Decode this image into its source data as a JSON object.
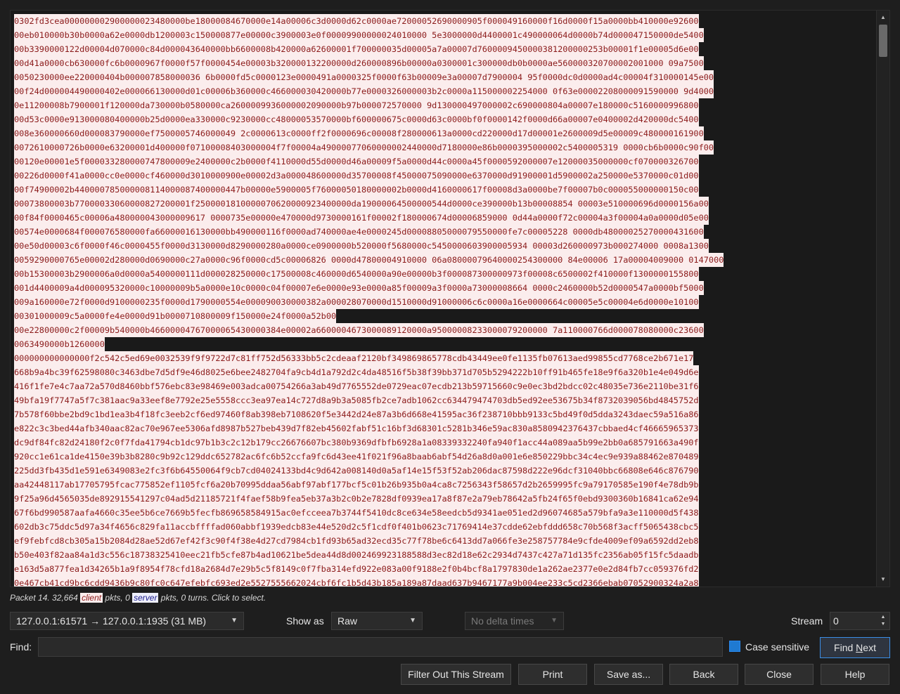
{
  "stream": {
    "segments": [
      {
        "direction": "client",
        "lines": [
          "0302fd3cea000000002900000023480000be18000084670000e14a00006c3d0000d62c0000ae72000052690000905f000049160000f16d0000f15a0000bb410000e92600",
          "00eb010000b30b0000a62e0000db1200003c150000877e00000c3900003e0f00009900000024010000 5e3000000d4400001c490000064d0000b74d000047150000de5400",
          "00b3390000122d00004d070000c84d000043640000bb6600008b420000a62600001f700000035d00005a7a00007d7600009450000381200000253b00001f1e00005d6e00",
          "00d41a0000cb630000fc6b0000967f0000f57f0000454e00003b320000132200000d260000896b00000a0300001c300000db0b0000ae560000320700002001000 09a7500",
          "0050230000ee220000404b000007858000036 6b0000fd5c0000123e0000491a0000325f0000f63b00009e3a00007d7900004 95f0000dc0d0000ad4c00004f310000145e00",
          "00f24d000004490000402e000066130000d01c00006b360000c466000030420000b77e0000326000003b2c0000a115000002254000 0f63e00002208000091590000 9d4000",
          "0e11200008b7900001f120000da730000b0580000ca2600009936000002090000b97b000072570000 9d130000497000002c690000804a00007e180000c5160000996800",
          "00d53c0000e913000080400000b25d0000ea330000c9230000cc48000053570000bf600000675c0000d63c0000bf0f0000142f0000d66a00007e0400002d420000dc5400",
          "008e360000660d000083790000ef7500005746000049 2c0000613c0000ff2f0000696c00008f280000613a0000cd220000d17d00001e2600009d5e00009c480000161900",
          "0072610000726b0000e63200001d400000f07100008403000004f7f00004a49000077060000002440000d7180000e86b0000395000002c5400005319 0000cb6b0000c90f00",
          "00120e00001e5f000033280000747800009e2400000c2b0000f4110000d55d0000d46a00009f5a0000d44c0000a45f0000592000007e12000035000000cf070000326700",
          "00226d0000f41a0000cc0e0000cf460000d3010000900e00002d3a000048600000d35700008f45000075090000e6370000d91900001d5900002a250000e5370000c01d00",
          "00f74900002b440000785000008114000087400000447b00000e5900005f76000050180000002b0000d4160000617f00008d3a0000be7f00007b0c000055000000150c00",
          "00073800003b77000033060000827200001f2500001810000070620000923400000da19000064500000544d0000ce390000b13b00008854 00003e510000696d0000156a00",
          "00f84f0000465c00006a480000043000009617 0000735e00000e470000d9730000161f00002f180000674d00006859000 0d44a0000f72c00004a3f00004a0a0000d05e00",
          "00574e0000684f000076580000fa66000016130000bb490000116f0000ad740000ae4e0000245d00008805000079550000fe7c00005228 0000db48000025270000431600",
          "00e50d00003c6f0000f46c0000455f0000d3130000d8290000280a0000ce0900000b520000f5680000c5450000603900005934 00003d260000973b000274000 0008a1300",
          "0059290000765e00002d280000d0690000c27a0000c96f0000cd5c00006826 0000d47800004910000 06a08000079640000254300000 84e00006 17a00004009000 0147000",
          "00b15300003b2900006a0d0000a5400000111d000028250000c17500008c460000d6540000a90e00000b3f000087300000973f00008c6500002f410000f1300000155800",
          "001d4400009a4d000095320000c10000009b5a0000e10c0000c04f00007e6e0000e93e0000a85f00009a3f0000a73000008664 0000c2460000b52d0000547a0000bf5000",
          "009a160000e72f0000d9100000235f0000d1790000554e000090030000382a000028070000d1510000d91000006c6c0000a16e0000664c00005e5c00004e6d0000e10100",
          "00301000009c5a0000fe4e0000d91b0000710800009f150000e24f0000a52b00"
        ]
      },
      {
        "direction": "client",
        "lines": [
          "00e22800000c2f00009b540000b46600004767000065430000384e00002a6600004673000089120000a95000008233000079200000 7a110000766d000078080000c23600",
          "0063490000b1260000"
        ]
      },
      {
        "direction": "client",
        "lines": [
          "000000000000000f2c542c5ed69e0032539f9f9722d7c81ff752d56333bb5c2cdeaaf2120bf349869865778cdb43449ee0fe1135fb07613aed99855cd7768ce2b671e17",
          "668b9a4bc39f62598080c3463dbe7d5df9e46d8025e6bee2482704fa9cb4d1a792d2c4da48516f5b38f39bb371d705b5294222b10ff91b465fe18e9f6a320b1e4e049d6e",
          "416f1fe7e4c7aa72a570d8460bbf576ebc83e98469e003adca00754266a3ab49d7765552de0729eac07ecdb213b59715660c9e0ec3bd2bdcc02c48035e736e2110be31f6",
          "49bfa19f7747a5f7c381aac9a33eef8e7792e25e5558ccc3ea97ea14c727d8a9b3a5085fb2ce7adb1062cc634479474703db5ed92ee53675b34f8732039056bd4845752d",
          "7b578f60bbe2bd9c1bd1ea3b4f18fc3eeb2cf6ed97460f8ab398eb7108620f5e3442d24e87a3b6d668e41595ac36f238710bbb9133c5bd49f0d5dda3243daec59a516a86",
          "e822c3c3bed44afb340aac82ac70e967ee5306afd8987b527beb439d7f82eb45602fabf51c16bf3d68301c5281b346e59ac830a8580942376437cbbaed4cf46665965373",
          "dc9df84fc82d24180f2c0f7fda41794cb1dc97b1b3c2c12b179cc26676607bc380b9369dfbfb6928a1a08339332240fa940f1acc44a089aa5b99e2bb0a685791663a490f",
          "920cc1e61ca1de4150e39b3b8280c9b92c129ddc652782ac6fc6b52ccfa9fc6d43ee41f021f96a8baab6abf54d26a8d0a001e6e850229bbc34c4ec9e939a88462e870489",
          "225dd3fb435d1e591e6349083e2fc3f6b64550064f9cb7cd04024133bd4c9d642a008140d0a5af14e15f53f52ab206dac87598d222e96dcf31040bbc66808e646c876790",
          "aa42448117ab17705795fcac775852ef1105fcf6a20b70995ddaa56abf97abf177bcf5c01b26b935b0a4ca8c7256343f58657d2b2659995fc9a79170585e190f4e78db9b",
          "9f25a96d4565035de892915541297c04ad5d21185721f4faef58b9fea5eb37a3b2c0b2e7828df0939ea17a8f87e2a79eb78642a5fb24f65f0ebd9300360b16841ca62e94",
          "67f6bd990587aafa4660c35ee5b6ce7669b5fecfb869658584915ac0efcceea7b3744f5410dc8ce634e58eedcb5d9341ae051ed2d96074685a579bfa9a3e110000d5f438",
          "602db3c75ddc5d97a34f4656c829fa11accbffffad060abbf1939edcb83e44e520d2c5f1cdf0f401b0623c71769414e37cdde62ebfddd658c70b568f3acff5065438cbc5",
          "ef9febfcd8cb305a15b2084d28ae52d67ef42f3c90f4f38e4d27cd7984cb1fd93b65ad32ecd35c77f78be6c6413dd7a066fe3e258757784e9cfde4009ef09a6592dd2eb8",
          "b50e403f82aa84a1d3c556c18738325410eec21fb5cfe87b4ad10621be5dea44d8d002469923188588d3ec82d18e62c2934d7437c427a71d135fc2356ab05f15fc5daadb",
          "e163d5a877fea1d34265b1a9f8954f78cfd18a2684d7e29b5c5f8149c0f7fba314efd922e083a00f9188e2f0b4bcf8a1797830de1a262ae2377e0e2d84fb7cc059376fd2",
          "0e467cb41cd9bc6cdd9436b9c80fc0c647efebfc693ed2e5527555662024cbf6fc1b5d43b185a189a87daad637b9467177a9b004ee233c5cd2366ebab07052900324a2a8"
        ]
      }
    ]
  },
  "status": {
    "prefix": "Packet 14. 32,664 ",
    "client_tag": "client",
    "middle": " pkts, 0 ",
    "server_tag": "server",
    "suffix": " pkts, 0 turns. Click to select."
  },
  "controls": {
    "conversation": "127.0.0.1:61571 → 127.0.0.1:1935 (31 MB)",
    "show_as_label": "Show as",
    "show_as_value": "Raw",
    "delta_value": "No delta times",
    "stream_label": "Stream",
    "stream_value": "0",
    "find_label": "Find:",
    "find_value": "",
    "case_sensitive_label": "Case sensitive",
    "find_next_prefix": "Find ",
    "find_next_underlined": "N",
    "find_next_suffix": "ext"
  },
  "buttons": {
    "filter_out": "Filter Out This Stream",
    "print": "Print",
    "save_as": "Save as...",
    "back": "Back",
    "close": "Close",
    "help": "Help"
  },
  "colors": {
    "client_bg": "#fbeded",
    "client_fg": "#8b1a1a",
    "server_bg": "#edeefb",
    "server_fg": "#1a1a8b",
    "accent": "#1f7ad1"
  }
}
